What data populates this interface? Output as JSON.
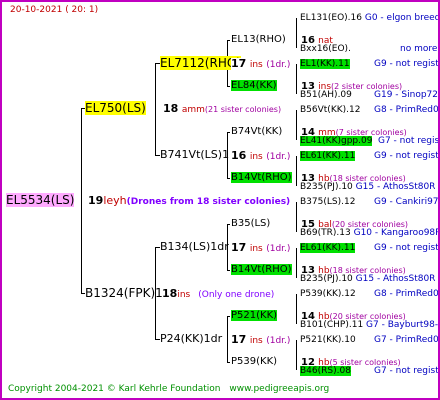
{
  "header": {
    "date": "20-10-2021",
    "time": "( 20: 1)"
  },
  "root": {
    "name": "EL5534(LS)",
    "num": "19",
    "code": "leyh",
    "info": "(Drones from 18 sister colonies)"
  },
  "g1a": {
    "name": "EL750(LS)",
    "num": "18",
    "code": "amm",
    "sis": "(21 sister colonies)"
  },
  "g1b": {
    "name": "B1324(FPK)1",
    "num": "18",
    "code": "ins",
    "info": "(Only one drone)"
  },
  "g2a": {
    "name": "EL7112(RHO)",
    "num": "17",
    "code": "ins",
    "sis": "(1dr.)"
  },
  "g2b": {
    "name": "B741Vt(LS)1",
    "num": "16",
    "code": "ins",
    "sis": "(1dr.)"
  },
  "g2c": {
    "name": "B134(LS)1dr",
    "num": "17",
    "code": "ins",
    "sis": "(1dr.)"
  },
  "g2d": {
    "name": "P24(KK)1dr",
    "num": "17",
    "code": "ins",
    "sis": "(1dr.)"
  },
  "g3": [
    {
      "name": "EL13(RHO)",
      "num": "16",
      "code": "nat",
      "sis": ""
    },
    {
      "name": "EL84(KK)",
      "num": "13",
      "code": "ins",
      "sis": "(2 sister colonies)"
    },
    {
      "name": "B74Vt(KK)",
      "num": "14",
      "code": "mm",
      "sis": "(7 sister colonies)"
    },
    {
      "name": "B14Vt(RHO)",
      "num": "13",
      "code": "hb",
      "sis": "(18 sister colonies)"
    },
    {
      "name": "B35(LS)",
      "num": "15",
      "code": "bal",
      "sis": "(20 sister colonies)"
    },
    {
      "name": "B14Vt(RHO)",
      "num": "13",
      "code": "hb",
      "sis": "(18 sister colonies)"
    },
    {
      "name": "P521(KK)",
      "num": "14",
      "code": "hb",
      "sis": "(20 sister colonies)"
    },
    {
      "name": "P539(KK)",
      "num": "12",
      "code": "hb",
      "sis": "(5 sister colonies)"
    }
  ],
  "g4": [
    {
      "name": "EL131(EO).16",
      "ref": "G0 - elgon breed"
    },
    {
      "name": "Bxx16(EO).",
      "ref": "no more"
    },
    {
      "name": "EL1(KK).11",
      "ref": "G9 - not registe"
    },
    {
      "name": "B51(AH).09",
      "ref": "G19 - Sinop72R"
    },
    {
      "name": "B56Vt(KK).12",
      "ref": "G8 - PrimRed01"
    },
    {
      "name": "EL41(KK)gpp.09",
      "ref": "G7 - not registe"
    },
    {
      "name": "EL61(KK).11",
      "ref": "G9 - not registe"
    },
    {
      "name": "B235(PJ).10",
      "ref": "G15 - AthosSt80R"
    },
    {
      "name": "B375(LS).12",
      "ref": "G9 - Cankiri97Q"
    },
    {
      "name": "B69(TR).13",
      "ref": "G10 - Kangaroo98R"
    },
    {
      "name": "EL61(KK).11",
      "ref": "G9 - not registe"
    },
    {
      "name": "B235(PJ).10",
      "ref": "G15 - AthosSt80R"
    },
    {
      "name": "P539(KK).12",
      "ref": "G8 - PrimRed01"
    },
    {
      "name": "B101(CHP).11",
      "ref": "G7 - Bayburt98-3"
    },
    {
      "name": "P521(KK).10",
      "ref": "G7 - PrimRed01"
    },
    {
      "name": "B46(RS).08",
      "ref": "G7 - not registe"
    }
  ],
  "footer": {
    "copyright": "Copyright 2004-2021 © Karl Kehrle Foundation",
    "site": "www.pedigreeapis.org"
  },
  "colors": {
    "frame": "#c000c0",
    "yellow": "#ffff00",
    "green": "#00e000",
    "pink": "#ffaaff"
  }
}
